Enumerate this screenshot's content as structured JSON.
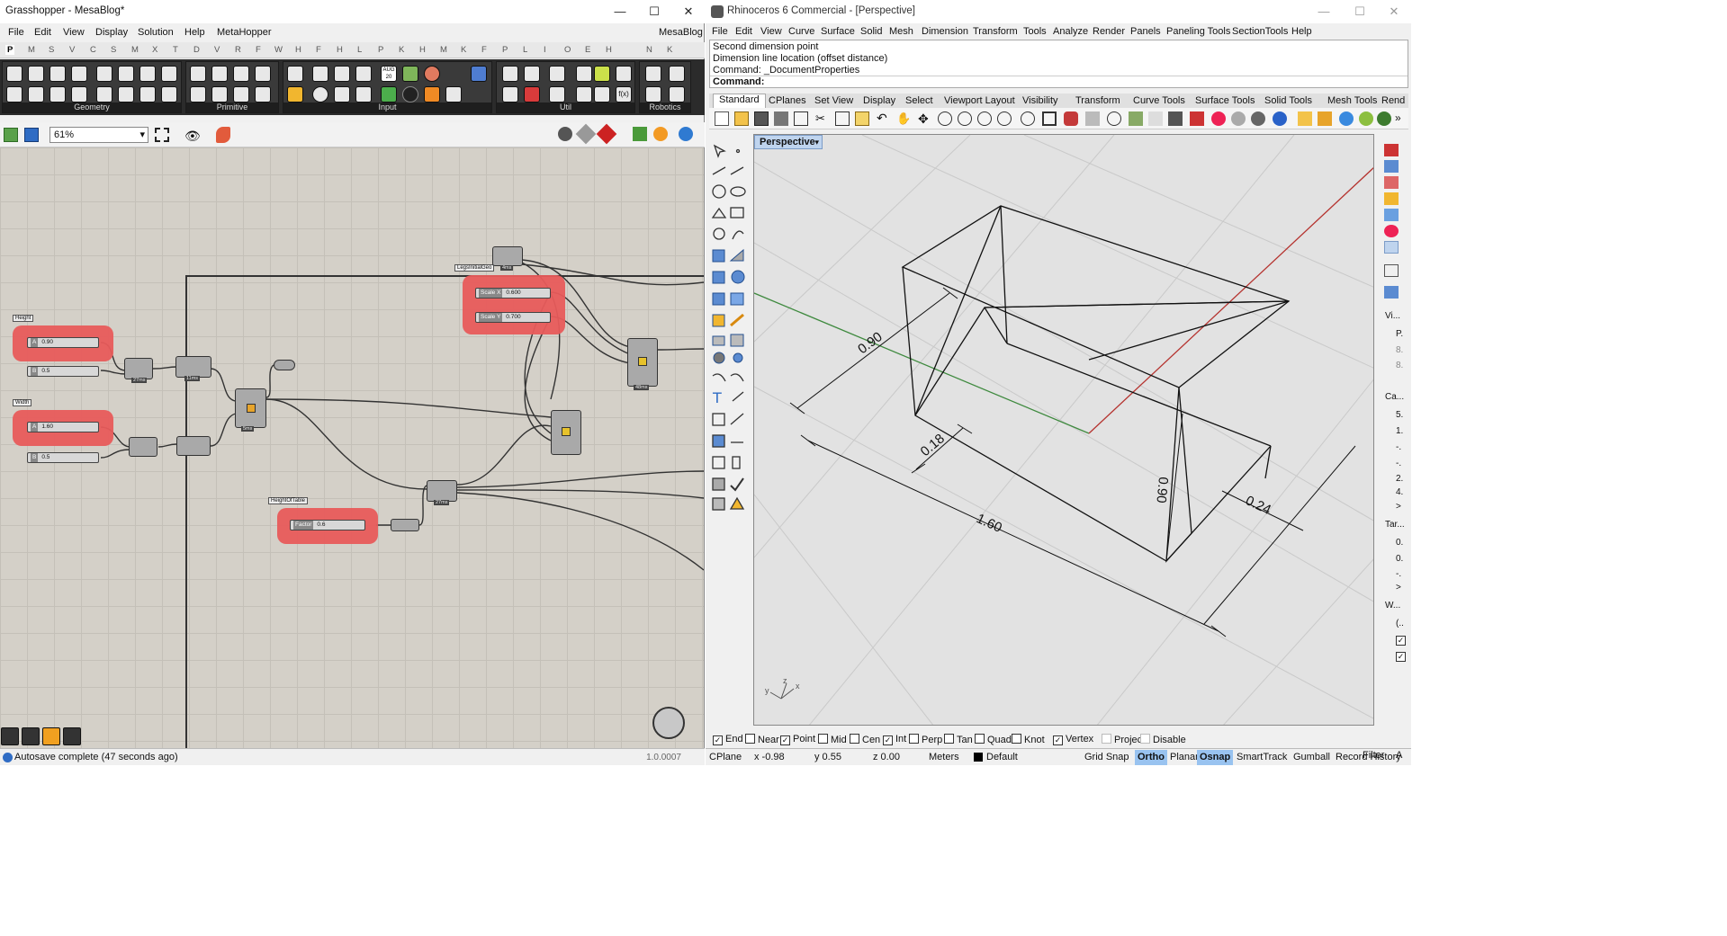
{
  "gh": {
    "title": "Grasshopper - MesaBlog*",
    "menu": [
      "File",
      "Edit",
      "View",
      "Display",
      "Solution",
      "Help",
      "MetaHopper"
    ],
    "doc_name": "MesaBlog",
    "tabs": [
      "P",
      "M",
      "S",
      "V",
      "C",
      "S",
      "M",
      "X",
      "T",
      "D",
      "V",
      "R",
      "F",
      "W",
      "H",
      "F",
      "H",
      "L",
      "P",
      "K",
      "H",
      "M",
      "K",
      "F",
      "P",
      "L",
      "I",
      "O",
      "E",
      "H",
      "N",
      "K"
    ],
    "ribbon_groups": [
      "Geometry",
      "Primitive",
      "Input",
      "Util",
      "Robotics"
    ],
    "ribbon_aug_icon": "AUG 20",
    "zoom": "61%",
    "canvas": {
      "group_tags": {
        "height": "Height",
        "width": "Width",
        "legs": "LegsInitialGeo",
        "height_table": "HeightOfTable"
      },
      "sliders": {
        "height_a": {
          "tag": "A",
          "value": "0.90"
        },
        "height_b": {
          "tag": "B",
          "value": "0.5"
        },
        "width_a": {
          "tag": "A",
          "value": "1.60"
        },
        "width_b": {
          "tag": "B",
          "value": "0.5"
        },
        "scale_x": {
          "tag": "Scale X",
          "value": "0.600"
        },
        "scale_y": {
          "tag": "Scale Y",
          "value": "0.700"
        },
        "factor": {
          "tag": "Factor",
          "value": "0.6"
        }
      },
      "times": {
        "t1": "27ms",
        "t2": "11ms",
        "t3": "5ms",
        "t4": "48ms",
        "t5": "27ms",
        "t6": "4ms"
      }
    },
    "status": "Autosave complete (47 seconds ago)",
    "version": "1.0.0007"
  },
  "rhino": {
    "title": "Rhinoceros 6 Commercial - [Perspective]",
    "menu": [
      "File",
      "Edit",
      "View",
      "Curve",
      "Surface",
      "Solid",
      "Mesh",
      "Dimension",
      "Transform",
      "Tools",
      "Analyze",
      "Render",
      "Panels",
      "Paneling Tools",
      "SectionTools",
      "Help"
    ],
    "command_history": [
      "Second dimension point",
      "Dimension line location (offset distance)",
      "Command: _DocumentProperties"
    ],
    "command_prompt": "Command:",
    "tabs": [
      "Standard",
      "CPlanes",
      "Set View",
      "Display",
      "Select",
      "Viewport Layout",
      "Visibility",
      "Transform",
      "Curve Tools",
      "Surface Tools",
      "Solid Tools",
      "Mesh Tools",
      "Rend"
    ],
    "viewport_label": "Perspective",
    "dimensions": {
      "d1": "0.90",
      "d2": "0.18",
      "d3": "1.60",
      "d4": "0.90",
      "d5": "0.24"
    },
    "axis": {
      "x": "x",
      "y": "y",
      "z": "z"
    },
    "right_panel": [
      "Vi...",
      "P.",
      "8.",
      "8.",
      "Ca...",
      "5.",
      "1.",
      "-.",
      "-.",
      "2.",
      "4.",
      ">",
      "Tar...",
      "0.",
      "0.",
      "-.",
      ">",
      "W...",
      "(.."
    ],
    "osnaps": [
      {
        "label": "End",
        "checked": true
      },
      {
        "label": "Near",
        "checked": false
      },
      {
        "label": "Point",
        "checked": true
      },
      {
        "label": "Mid",
        "checked": false
      },
      {
        "label": "Cen",
        "checked": false
      },
      {
        "label": "Int",
        "checked": true
      },
      {
        "label": "Perp",
        "checked": false
      },
      {
        "label": "Tan",
        "checked": false
      },
      {
        "label": "Quad",
        "checked": false
      },
      {
        "label": "Knot",
        "checked": false
      },
      {
        "label": "Vertex",
        "checked": true
      },
      {
        "label": "Project",
        "checked": false
      },
      {
        "label": "Disable",
        "checked": false
      }
    ],
    "status": {
      "cplane": "CPlane",
      "x": "x -0.98",
      "y": "y 0.55",
      "z": "z 0.00",
      "units": "Meters",
      "layer": "Default",
      "grid_snap": "Grid Snap",
      "ortho": "Ortho",
      "planar": "Planar",
      "osnap": "Osnap",
      "smarttrack": "SmartTrack",
      "gumball": "Gumball",
      "record_history": "Record History",
      "filter": "Filter",
      "more": "A"
    },
    "colors": {
      "viewport_bg": "#e2e2e2",
      "active_toggle": "#99c3f0",
      "x_axis": "#b5332f",
      "y_axis": "#3f8a3f"
    }
  }
}
